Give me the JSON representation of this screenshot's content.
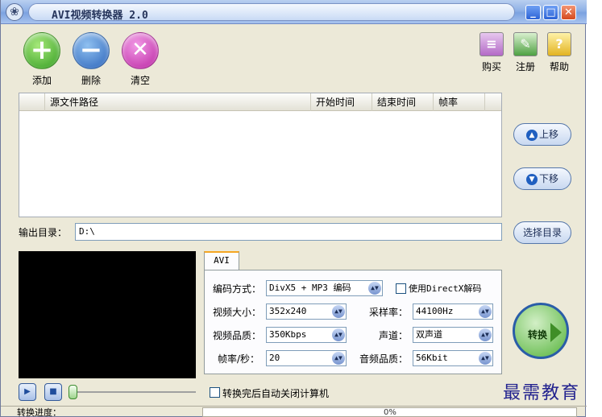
{
  "window": {
    "title": "AVI视频转换器 2.0",
    "min_symbol": "_",
    "max_symbol": "□",
    "close_symbol": "✕",
    "logo_symbol": "❀"
  },
  "toolbar": {
    "add_label": "添加",
    "delete_label": "删除",
    "clear_label": "清空",
    "buy_label": "购买",
    "register_label": "注册",
    "help_label": "帮助"
  },
  "filelist": {
    "columns": [
      "源文件路径",
      "开始时间",
      "结束时间",
      "帧率"
    ],
    "rows": []
  },
  "side": {
    "move_up_label": "上移",
    "move_down_label": "下移",
    "choose_dir_label": "选择目录"
  },
  "output": {
    "label": "输出目录：",
    "value": "D:\\"
  },
  "settings": {
    "tab_label": "AVI",
    "codec_label": "编码方式：",
    "codec_value": "DivX5 + MP3 编码",
    "directx_label": "使用DirectX解码",
    "directx_checked": false,
    "video_size_label": "视频大小：",
    "video_size_value": "352x240",
    "sample_rate_label": "采样率：",
    "sample_rate_value": "44100Hz",
    "video_quality_label": "视频品质：",
    "video_quality_value": "350Kbps",
    "channel_label": "声道：",
    "channel_value": "双声道",
    "fps_label": "帧率/秒：",
    "fps_value": "20",
    "audio_quality_label": "音频品质：",
    "audio_quality_value": "56Kbit"
  },
  "convert": {
    "label": "转换"
  },
  "player": {
    "auto_shutdown_label": "转换完后自动关闭计算机",
    "auto_shutdown_checked": false,
    "slider_level": 0
  },
  "status": {
    "progress_label": "转换进度：",
    "progress_text": "0%",
    "progress_value": 0
  },
  "watermark": "最需教育",
  "colors": {
    "accent": "#1f5fc0",
    "tab_accent": "#f5a623",
    "watermark": "#23238f"
  }
}
